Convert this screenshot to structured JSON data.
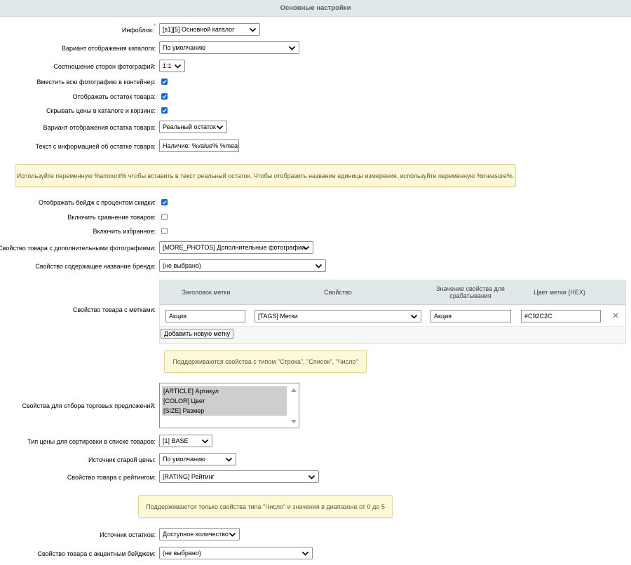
{
  "header": {
    "title": "Основные настройки"
  },
  "fields": {
    "iblock": {
      "label": "Инфоблок:",
      "required_mark": "*",
      "value": "[s1][5] Основной каталог"
    },
    "view_mode": {
      "label": "Вариант отображения каталога:",
      "value": "По умолчанию"
    },
    "ratio": {
      "label": "Соотношение сторон фотографий:",
      "value": "1:1"
    },
    "fit_photo": {
      "label": "Вместить всю фотографию в контейнер:",
      "checked": true
    },
    "show_quantity": {
      "label": "Отображать остаток товара:",
      "checked": true
    },
    "hide_prices": {
      "label": "Скрывать цены в каталоге и корзине:",
      "checked": true
    },
    "quantity_view": {
      "label": "Вариант отображения остатка товара:",
      "value": "Реальный остаток"
    },
    "quantity_text": {
      "label": "Текст с информацией об остатке товара:",
      "value": "Наличие: %value% %measure%"
    },
    "discount_badge": {
      "label": "Отображать бейдж с процентом скидки:",
      "checked": true
    },
    "compare": {
      "label": "Включить сравнение товаров:",
      "checked": false
    },
    "favorites": {
      "label": "Включить избранное:",
      "checked": false
    },
    "more_photos": {
      "label": "Свойство товара с дополнительными фотографиями:",
      "value": "[MORE_PHOTOS] Дополнительные фотографии"
    },
    "brand": {
      "label": "Свойство содержащее название бренда:",
      "value": "(не выбрано)"
    },
    "labels": {
      "label": "Свойство товара с метками:"
    },
    "offers_props": {
      "label": "Свойства для отбора торговых предложений:"
    },
    "price_type": {
      "label": "Тип цены для сортировки в списке товаров:",
      "value": "[1] BASE"
    },
    "old_price": {
      "label": "Источник старой цены:",
      "value": "По умолчанию"
    },
    "rating": {
      "label": "Свойство товара с рейтингом:",
      "value": "[RATING] Рейтинг"
    },
    "stock_source": {
      "label": "Источник остатков:",
      "value": "Доступное количество"
    },
    "accent_badge": {
      "label": "Свойство товара с акцентным бейджем:",
      "value": "(не выбрано)"
    }
  },
  "hints": {
    "quantity_hint": "Используйте переменную %amount% чтобы вставить в текст реальный остаток. Чтобы отобразить название единицы измерения, используйте переменную %measure%.",
    "labels_hint": "Поддерживаются свойства с типом \"Строка\", \"Список\", \"Число\"",
    "rating_hint": "Поддерживаются только свойства типа \"Число\" и значения в диапазоне от 0 до 5"
  },
  "labels_table": {
    "headers": {
      "title": "Заголовок метки",
      "property": "Свойство",
      "value": "Значение свойства для срабатывания",
      "color": "Цвет метки (HEX)"
    },
    "rows": [
      {
        "title": "Акция",
        "property": "[TAGS] Метки",
        "value": "Акция",
        "color": "#C92C2C"
      }
    ],
    "add_button": "Добавить новую метку"
  },
  "offers_listbox": {
    "options": [
      "[ARTICLE] Артикул",
      "[COLOR] Цвет",
      "[SIZE] Размер"
    ]
  },
  "icons": {
    "dropdown": "chevron-down-icon",
    "checkbox": "checkmark-icon",
    "delete": "close-icon",
    "scroll_up": "triangle-up-icon",
    "scroll_down": "triangle-down-icon"
  },
  "colors": {
    "header_bg": "#e0e8ea",
    "header_text": "#4b6267",
    "checkbox": "#1867d1",
    "hint_bg": "#fdf8d8",
    "hint_border": "#e0d497"
  }
}
